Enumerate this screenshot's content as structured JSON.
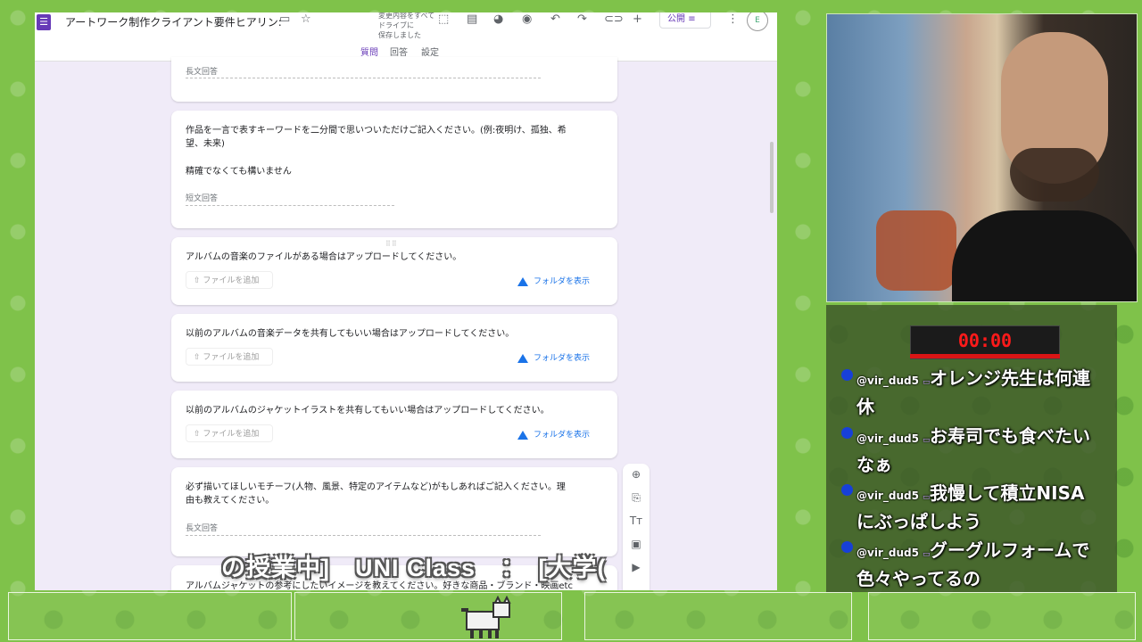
{
  "header": {
    "title": "アートワーク制作クライアント要件ヒアリン:",
    "autosave_line1": "変更内容をすべてドライブに",
    "autosave_line2": "保存しました",
    "publish_label": "公開",
    "tabs": [
      "質問",
      "回答",
      "設定"
    ]
  },
  "questions": [
    {
      "answer_placeholder": "長文回答"
    },
    {
      "text_line1": "作品を一言で表すキーワードを二分間で思いついただけご記入ください。(例:夜明け、孤独、希",
      "text_line2": "望、未来)",
      "text_line3": "精確でなくても構いません",
      "answer_placeholder": "短文回答"
    },
    {
      "text": "アルバムの音楽のファイルがある場合はアップロードしてください。",
      "upload_label": "ファイルを追加",
      "folder_label": "フォルダを表示"
    },
    {
      "text": "以前のアルバムの音楽データを共有してもいい場合はアップロードしてください。",
      "upload_label": "ファイルを追加",
      "folder_label": "フォルダを表示"
    },
    {
      "text": "以前のアルバムのジャケットイラストを共有してもいい場合はアップロードしてください。",
      "upload_label": "ファイルを追加",
      "folder_label": "フォルダを表示"
    },
    {
      "text_line1": "必ず描いてほしいモチーフ(人物、風景、特定のアイテムなど)がもしあればご記入ください。理",
      "text_line2": "由も教えてください。",
      "answer_placeholder": "長文回答"
    },
    {
      "text": "アルバムジャケットの参考にしたいイメージを教えてください。好きな商品・ブランド・映画etc"
    }
  ],
  "overlay": {
    "ticker": "の授業中]　UNI Class　：　[大学("
  },
  "timer": "00:00",
  "chat": [
    {
      "user": "@vir_dud5",
      "text": "オレンジ先生は何連休"
    },
    {
      "user": "@vir_dud5",
      "text": "お寿司でも食べたいなぁ"
    },
    {
      "user": "@vir_dud5",
      "text": "我慢して積立NISAにぶっぱしよう"
    },
    {
      "user": "@vir_dud5",
      "text": "グーグルフォームで色々やってるの"
    }
  ],
  "colors": {
    "forms_accent": "#673ab7",
    "drive_blue": "#1a73e8",
    "timer_red": "#ff1a1a"
  },
  "icons": [
    "forms-logo-icon",
    "folder-icon",
    "star-icon",
    "palette-icon",
    "eye-icon",
    "undo-icon",
    "redo-icon",
    "link-icon",
    "add-person-icon",
    "more-icon",
    "upload-icon",
    "drive-icon",
    "add-question-icon",
    "import-icon",
    "title-icon",
    "image-icon"
  ]
}
